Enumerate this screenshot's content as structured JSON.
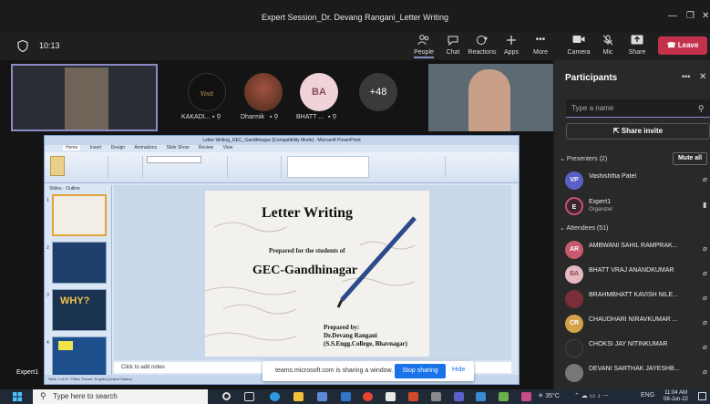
{
  "window": {
    "title": "Expert Session_Dr. Devang Rangani_Letter Writing"
  },
  "toolbar": {
    "timer": "10:13",
    "buttons": [
      {
        "label": "People"
      },
      {
        "label": "Chat"
      },
      {
        "label": "Reactions"
      },
      {
        "label": "Apps"
      },
      {
        "label": "More"
      },
      {
        "label": "Camera"
      },
      {
        "label": "Mic"
      },
      {
        "label": "Share"
      }
    ],
    "leave_label": "Leave"
  },
  "gallery": {
    "tiles": [
      {
        "name": "KAKADI...",
        "initials": ""
      },
      {
        "name": "Dharmik",
        "initials": ""
      },
      {
        "name": "BHATT ...",
        "initials": "BA"
      }
    ],
    "overflow": "+48"
  },
  "ppt": {
    "title": "Letter Writing_GEC_Gandhinagar [Compatibility Mode] - Microsoft PowerPoint",
    "tabs": [
      "Home",
      "Insert",
      "Design",
      "Animations",
      "Slide Show",
      "Review",
      "View"
    ],
    "left_tabs": [
      "Slides",
      "Outline"
    ],
    "thumb_numbers": [
      "1",
      "2",
      "3",
      "4"
    ],
    "slide": {
      "title": "Letter Writing",
      "prepared_for": "Prepared for the students of",
      "institution": "GEC-Gandhinagar",
      "prepared_by": "Prepared by:",
      "author": "Dr.Devang Rangani",
      "college": "(S.S.Engg.College, Bhavnagar)"
    },
    "notes_placeholder": "Click to add notes",
    "status": "Slide 1 of 11    \"Office Theme\"    English (United States)"
  },
  "share_bar": {
    "text": "teams.microsoft.com is sharing a window.",
    "stop_label": "Stop sharing",
    "hide_label": "Hide"
  },
  "presenter_label": "Expert1",
  "participants": {
    "title": "Participants",
    "search_placeholder": "Type a name",
    "share_invite": "Share invite",
    "presenters_header": "Presenters (2)",
    "mute_all": "Mute all",
    "presenters": [
      {
        "initials": "VP",
        "name": "Vashishtha Patel",
        "role": "",
        "color": "#5b5fc7"
      },
      {
        "initials": "E",
        "name": "Expert1",
        "role": "Organizer",
        "color": "#c4517a"
      }
    ],
    "attendees_header": "Attendees (51)",
    "attendees": [
      {
        "initials": "AR",
        "name": "AMBWANI SAHIL RAMPRAK...",
        "color": "#c75a6d"
      },
      {
        "initials": "BA",
        "name": "BHATT VRAJ ANANDKUMAR",
        "color": "#e6b8c2"
      },
      {
        "initials": "",
        "name": "BRAHMBHATT KAVISH NILE...",
        "color": "#7a2e38"
      },
      {
        "initials": "CR",
        "name": "CHAUDHARI NIRAVKUMAR ...",
        "color": "#d2a14a"
      },
      {
        "initials": "",
        "name": "CHOKSI JAY NITINKUMAR",
        "color": "#2a2a2a"
      },
      {
        "initials": "",
        "name": "DEVANI SARTHAK JAYESHB...",
        "color": "#777"
      }
    ]
  },
  "taskbar": {
    "search_placeholder": "Type here to search",
    "weather": "35°C",
    "lang": "ENG",
    "time": "11:04 AM",
    "date": "08-Jun-22"
  }
}
